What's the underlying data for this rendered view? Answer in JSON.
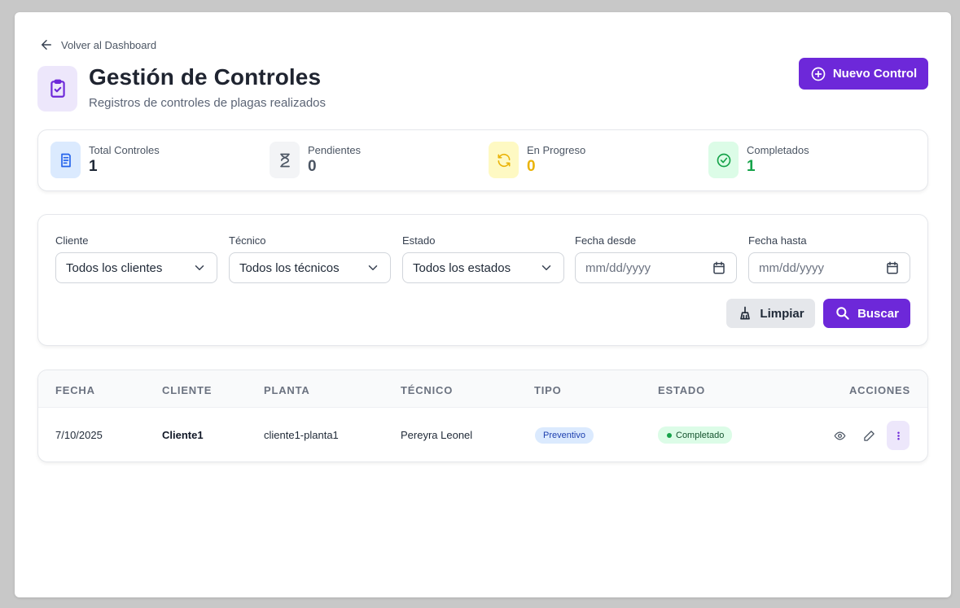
{
  "nav": {
    "back_label": "Volver al Dashboard"
  },
  "header": {
    "title": "Gestión de Controles",
    "subtitle": "Registros de controles de plagas realizados",
    "new_button_label": "Nuevo Control"
  },
  "stats": [
    {
      "label": "Total Controles",
      "value": "1",
      "icon": "document-icon",
      "color": "#2563eb",
      "bg": "#dbeafe"
    },
    {
      "label": "Pendientes",
      "value": "0",
      "icon": "hourglass-icon",
      "color": "#4b5563",
      "bg": "#f3f4f6"
    },
    {
      "label": "En Progreso",
      "value": "0",
      "icon": "refresh-icon",
      "color": "#eab308",
      "bg": "#fef9c3"
    },
    {
      "label": "Completados",
      "value": "1",
      "icon": "check-circle-icon",
      "color": "#16a34a",
      "bg": "#dcfce7"
    }
  ],
  "filters": {
    "cliente": {
      "label": "Cliente",
      "value": "Todos los clientes"
    },
    "tecnico": {
      "label": "Técnico",
      "value": "Todos los técnicos"
    },
    "estado": {
      "label": "Estado",
      "value": "Todos los estados"
    },
    "fecha_desde": {
      "label": "Fecha desde",
      "placeholder": "mm/dd/yyyy"
    },
    "fecha_hasta": {
      "label": "Fecha hasta",
      "placeholder": "mm/dd/yyyy"
    },
    "clear_label": "Limpiar",
    "search_label": "Buscar"
  },
  "table": {
    "headers": {
      "fecha": "FECHA",
      "cliente": "CLIENTE",
      "planta": "PLANTA",
      "tecnico": "TÉCNICO",
      "tipo": "TIPO",
      "estado": "ESTADO",
      "acciones": "ACCIONES"
    },
    "rows": [
      {
        "fecha": "7/10/2025",
        "cliente": "Cliente1",
        "planta": "cliente1-planta1",
        "tecnico": "Pereyra Leonel",
        "tipo": "Preventivo",
        "estado": "Completado"
      }
    ]
  },
  "colors": {
    "accent": "#6d28d9",
    "accent_light": "#ede7fb",
    "success": "#16a34a",
    "info": "#2563eb",
    "warning": "#eab308"
  }
}
